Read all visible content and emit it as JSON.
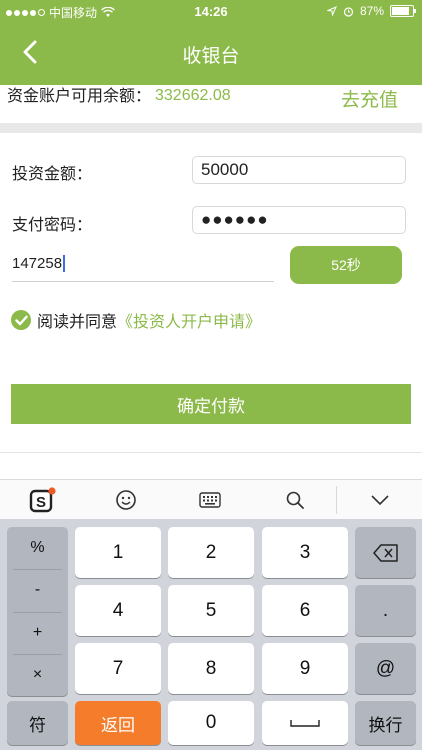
{
  "status_bar": {
    "carrier": "中国移动",
    "time": "14:26",
    "battery": "87%",
    "battery_level": 0.87
  },
  "nav": {
    "title": "收银台",
    "back_icon": "chevron-left-icon"
  },
  "balance": {
    "label": "资金账户可用余额：",
    "amount": "332662.08",
    "recharge_label": "去充值"
  },
  "form": {
    "amount_label": "投资金额：",
    "amount_value": "50000",
    "password_label": "支付密码：",
    "password_value": "●●●●●●",
    "code_value": "147258",
    "countdown_label": "52秒"
  },
  "agreement": {
    "text": "阅读并同意",
    "link": "《投资人开户申请》"
  },
  "pay_button": "确定付款",
  "keyboard": {
    "toolbar_icons": [
      "sogou-logo-icon",
      "emoji-icon",
      "keyboard-icon",
      "search-icon",
      "collapse-keyboard-icon"
    ],
    "side_keys": [
      "%",
      "-",
      "+",
      "×"
    ],
    "digits": [
      "1",
      "2",
      "3",
      "4",
      "5",
      "6",
      "7",
      "8",
      "9",
      "0"
    ],
    "symbol_key": "符",
    "back_key": "返回",
    "space_key": "␣",
    "dot_key": ".",
    "at_key": "@",
    "enter_key": "换行"
  },
  "colors": {
    "accent": "#8cba4a",
    "keyboard_bg": "#d1d4da",
    "return_key": "#f47c2a"
  }
}
